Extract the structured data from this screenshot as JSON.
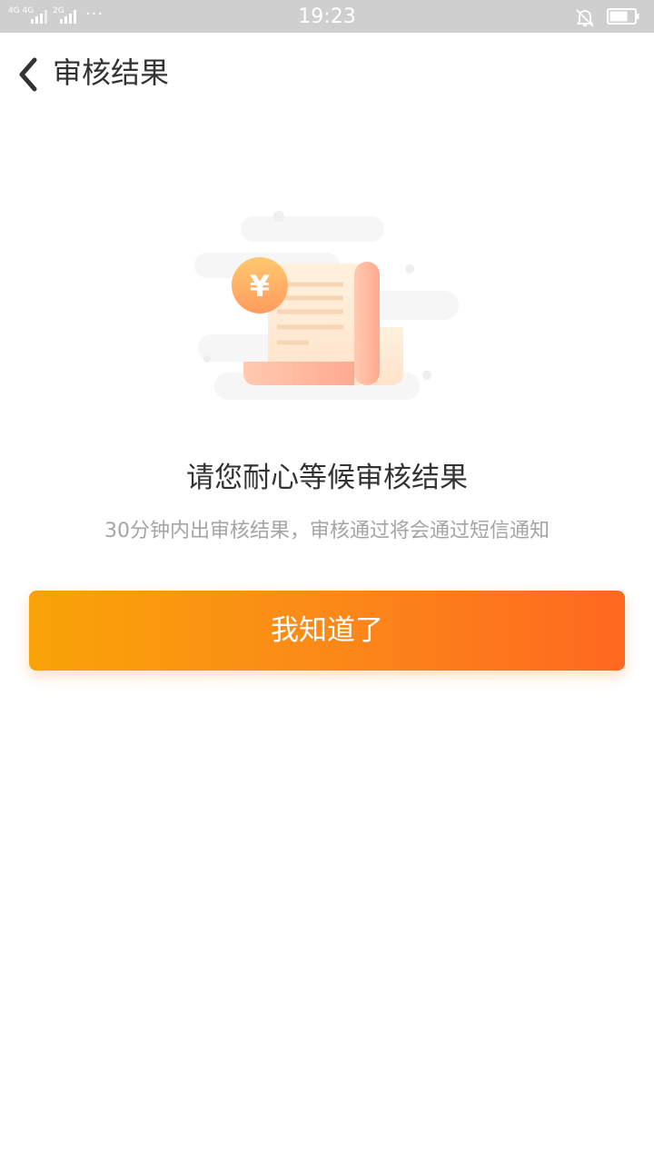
{
  "status_bar": {
    "sim1": "4G 4G",
    "sim2": "2G",
    "more_dots": "···",
    "time": "19:23",
    "icons": [
      "signal-icon",
      "bell-off-icon",
      "battery-icon"
    ]
  },
  "navbar": {
    "back_icon": "chevron-left-icon",
    "title": "审核结果"
  },
  "illustration": {
    "icon": "receipt-yuan-icon",
    "coin_symbol": "¥"
  },
  "message": {
    "title": "请您耐心等候审核结果",
    "subtitle": "30分钟内出审核结果，审核通过将会通过短信通知"
  },
  "button": {
    "label": "我知道了"
  },
  "colors": {
    "statusbar_bg": "#cfcfcf",
    "button_start": "#f9a307",
    "button_end": "#ff6820",
    "title_text": "#333333",
    "subtitle_text": "#a5a5a5"
  }
}
